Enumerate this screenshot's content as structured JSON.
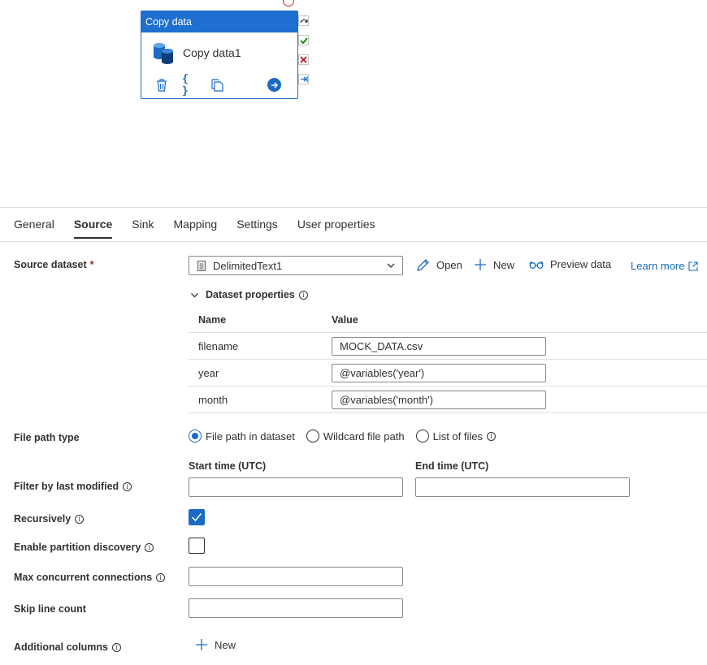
{
  "canvas": {
    "node": {
      "header": "Copy data",
      "name": "Copy data1",
      "actions": [
        "delete-icon",
        "code-icon",
        "copy-icon",
        "navigate-icon"
      ]
    },
    "outputs": [
      "skip-icon",
      "success-icon",
      "failure-icon",
      "completion-icon"
    ]
  },
  "tabs": [
    {
      "label": "General",
      "active": false
    },
    {
      "label": "Source",
      "active": true
    },
    {
      "label": "Sink",
      "active": false
    },
    {
      "label": "Mapping",
      "active": false
    },
    {
      "label": "Settings",
      "active": false
    },
    {
      "label": "User properties",
      "active": false
    }
  ],
  "source": {
    "dataset_label": "Source dataset",
    "required_mark": "*",
    "dataset_value": "DelimitedText1",
    "open_label": "Open",
    "new_label": "New",
    "preview_label": "Preview data",
    "learn_more_label": "Learn more",
    "dataset_properties_label": "Dataset properties",
    "table": {
      "name_header": "Name",
      "value_header": "Value",
      "rows": [
        {
          "name": "filename",
          "value": "MOCK_DATA.csv"
        },
        {
          "name": "year",
          "value": "@variables('year')"
        },
        {
          "name": "month",
          "value": "@variables('month')"
        }
      ]
    },
    "file_path_type_label": "File path type",
    "file_path_options": [
      {
        "label": "File path in dataset",
        "selected": true
      },
      {
        "label": "Wildcard file path",
        "selected": false
      },
      {
        "label": "List of files",
        "selected": false
      }
    ],
    "start_time_label": "Start time (UTC)",
    "end_time_label": "End time (UTC)",
    "filter_label": "Filter by last modified",
    "recursively_label": "Recursively",
    "recursively_checked": true,
    "partition_label": "Enable partition discovery",
    "partition_checked": false,
    "max_conn_label": "Max concurrent connections",
    "skip_line_label": "Skip line count",
    "additional_columns_label": "Additional columns",
    "additional_new_label": "New"
  },
  "colors": {
    "accent": "#1b6bc4",
    "node_header": "#1e6fcf",
    "link": "#0f6cbd",
    "required": "#a4262c"
  }
}
